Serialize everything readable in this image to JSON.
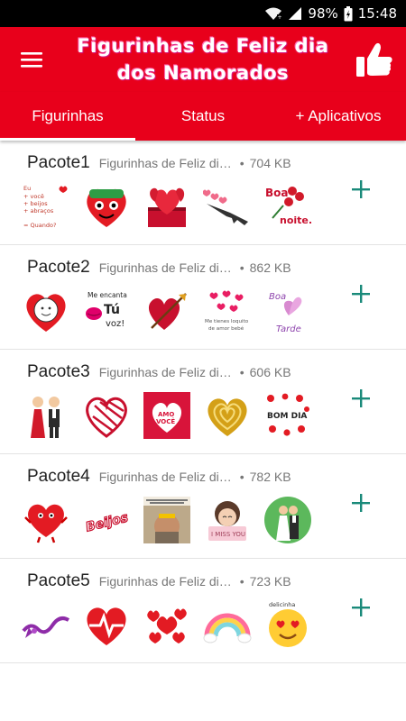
{
  "statusbar": {
    "battery": "98%",
    "time": "15:48"
  },
  "header": {
    "title_line1": "Figurinhas de Feliz dia",
    "title_line2": "dos Namorados"
  },
  "tabs": [
    {
      "label": "Figurinhas"
    },
    {
      "label": "Status"
    },
    {
      "label": "+ Aplicativos"
    }
  ],
  "packs": [
    {
      "name": "Pacote1",
      "description": "Figurinhas de Feliz dia dos Namorados",
      "dot": "•",
      "size": "704 KB",
      "sticker_text": {
        "eu": "Eu",
        "voce": "+ você",
        "beijos": "+ beijos",
        "abracos": "+ abraços",
        "quando": "= Quando?",
        "boa": "Boa",
        "noite": "noite."
      }
    },
    {
      "name": "Pacote2",
      "description": "Figurinhas de Feliz dia dos Namorados",
      "dot": "•",
      "size": "862 KB",
      "sticker_text": {
        "me_encanta": "Me encanta",
        "tu": "Tú",
        "voz": "voz!",
        "te_tienes": "Me tienes loquito",
        "amor": "de amor bebé",
        "boa": "Boa",
        "tarde": "Tarde"
      }
    },
    {
      "name": "Pacote3",
      "description": "Figurinhas de Feliz dia dos Namorados",
      "dot": "•",
      "size": "606 KB",
      "sticker_text": {
        "amo": "AMO",
        "voce": "VOCÊ",
        "bom_dia": "BOM DIA"
      }
    },
    {
      "name": "Pacote4",
      "description": "Figurinhas de Feliz dia dos Namorados",
      "dot": "•",
      "size": "782 KB",
      "sticker_text": {
        "beijos": "Beijos",
        "miss_you": "I MISS YOU"
      }
    },
    {
      "name": "Pacote5",
      "description": "Figurinhas de Feliz dia dos Namorados",
      "dot": "•",
      "size": "723 KB",
      "sticker_text": {
        "delicinha": "delicinha"
      }
    }
  ],
  "colors": {
    "primary": "#e8001b",
    "accent": "#1a8a7a"
  },
  "icons": {
    "menu": "hamburger-icon",
    "like": "thumbs-up-icon",
    "add": "plus-icon"
  }
}
